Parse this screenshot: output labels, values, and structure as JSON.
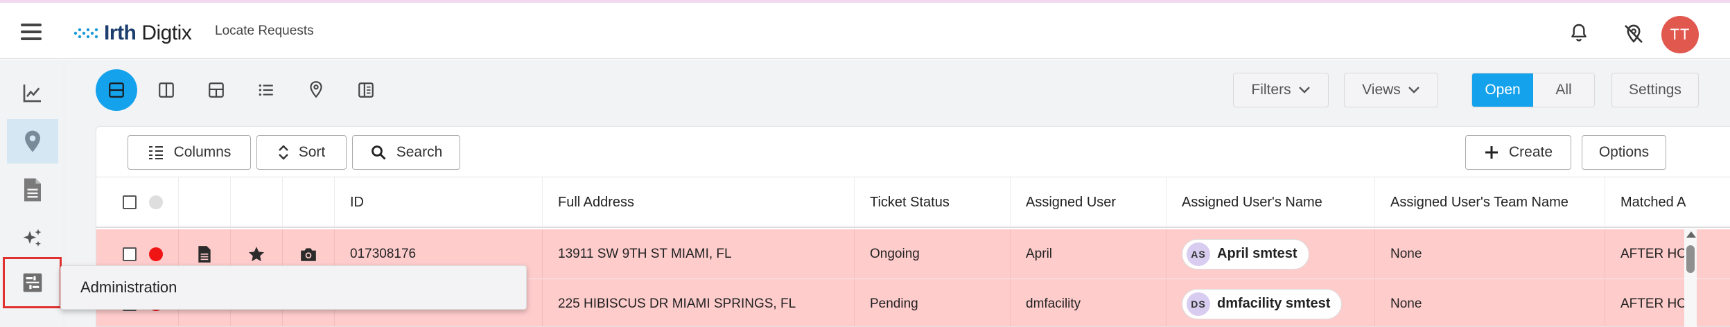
{
  "app": {
    "logo_text_1": "Irth",
    "logo_text_2": "Digtix",
    "page_title": "Locate Requests",
    "user_initials": "TT"
  },
  "sidebar": {
    "items": [
      {
        "icon": "trend-chart-icon"
      },
      {
        "icon": "map-pin-icon",
        "active": true
      },
      {
        "icon": "document-icon"
      },
      {
        "icon": "sparkles-icon"
      },
      {
        "icon": "admin-panel-icon",
        "highlighted": true
      }
    ],
    "tooltip": "Administration"
  },
  "toolbar": {
    "view_modes": [
      "single-panel-view-icon",
      "split-vertical-view-icon",
      "split-quad-view-icon",
      "list-view-icon",
      "map-view-icon",
      "side-panel-view-icon"
    ],
    "filters_label": "Filters",
    "views_label": "Views",
    "open_label": "Open",
    "all_label": "All",
    "settings_label": "Settings"
  },
  "table_toolbar": {
    "columns_label": "Columns",
    "sort_label": "Sort",
    "search_label": "Search",
    "create_label": "Create",
    "options_label": "Options"
  },
  "table": {
    "columns": [
      "ID",
      "Full Address",
      "Ticket Status",
      "Assigned User",
      "Assigned User's Name",
      "Assigned User's Team Name",
      "Matched A"
    ],
    "rows": [
      {
        "id": "017308176",
        "address": "13911 SW 9TH ST MIAMI, FL",
        "status": "Ongoing",
        "user": "April",
        "user_initials": "AS",
        "user_name": "April smtest",
        "team": "None",
        "matched": "AFTER HO"
      },
      {
        "id": "",
        "address": "225 HIBISCUS DR MIAMI SPRINGS, FL",
        "status": "Pending",
        "user": "dmfacility",
        "user_initials": "DS",
        "user_name": "dmfacility smtest",
        "team": "None",
        "matched": "AFTER HO"
      }
    ]
  },
  "colors": {
    "accent": "#15a2ec",
    "row_highlight": "#ffcccc",
    "status_dot": "#f01515",
    "avatar": "#e0584e"
  }
}
